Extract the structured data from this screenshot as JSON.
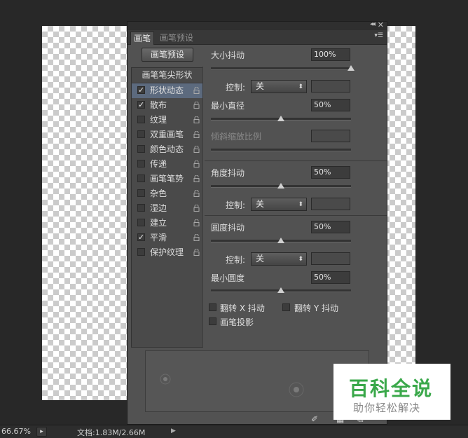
{
  "panel": {
    "tabs": [
      "画笔",
      "画笔预设"
    ],
    "preset_button": "画笔预设",
    "list_header": "画笔笔尖形状",
    "items": [
      {
        "label": "形状动态",
        "checked": true,
        "selected": true
      },
      {
        "label": "散布",
        "checked": true,
        "selected": false
      },
      {
        "label": "纹理",
        "checked": false,
        "selected": false
      },
      {
        "label": "双重画笔",
        "checked": false,
        "selected": false
      },
      {
        "label": "颜色动态",
        "checked": false,
        "selected": false
      },
      {
        "label": "传递",
        "checked": false,
        "selected": false
      },
      {
        "label": "画笔笔势",
        "checked": false,
        "selected": false
      },
      {
        "label": "杂色",
        "checked": false,
        "selected": false
      },
      {
        "label": "湿边",
        "checked": false,
        "selected": false
      },
      {
        "label": "建立",
        "checked": false,
        "selected": false
      },
      {
        "label": "平滑",
        "checked": true,
        "selected": false
      },
      {
        "label": "保护纹理",
        "checked": false,
        "selected": false
      }
    ],
    "settings": {
      "size_jitter_label": "大小抖动",
      "size_jitter_value": "100%",
      "control_label": "控制:",
      "control_value": "关",
      "min_diameter_label": "最小直径",
      "min_diameter_value": "50%",
      "tilt_scale_label": "倾斜缩放比例",
      "angle_jitter_label": "角度抖动",
      "angle_jitter_value": "50%",
      "roundness_jitter_label": "圆度抖动",
      "roundness_jitter_value": "50%",
      "min_roundness_label": "最小圆度",
      "min_roundness_value": "50%",
      "flip_x_label": "翻转 X 抖动",
      "flip_y_label": "翻转 Y 抖动",
      "brush_projection_label": "画笔投影"
    },
    "slider_levels": {
      "size_jitter": 1.0,
      "min_diameter": 0.5,
      "angle_jitter": 0.5,
      "roundness_jitter": 0.5,
      "min_roundness": 0.5
    }
  },
  "statusbar": {
    "zoom": "66.67%",
    "doc_info": "文档:1.83M/2.66M"
  },
  "watermark": {
    "title": "百科全说",
    "subtitle": "助你轻松解决"
  }
}
